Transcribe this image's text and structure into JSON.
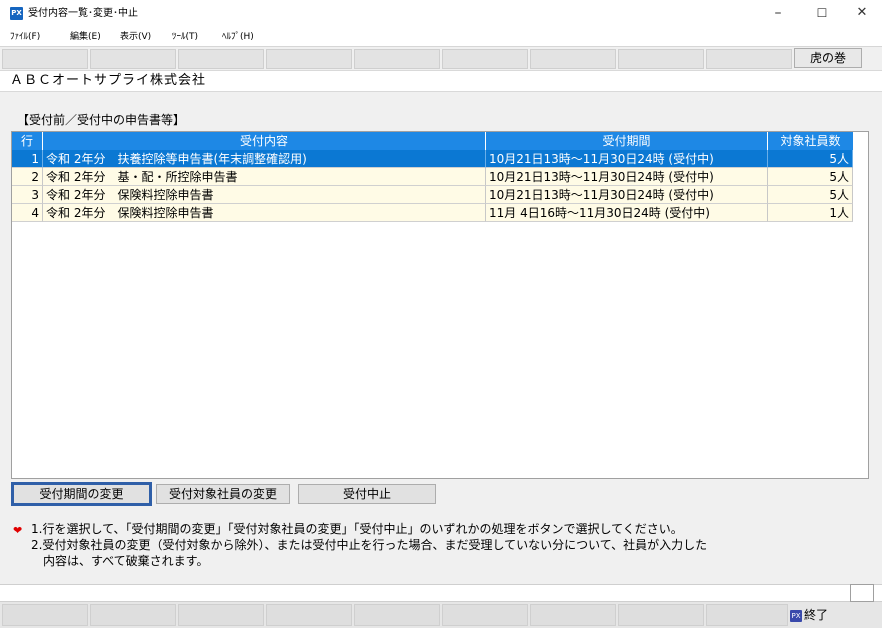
{
  "window": {
    "app_icon_text": "PX",
    "title": "受付内容一覧･変更･中止",
    "minimize_glyph": "–",
    "maximize_glyph": "☐",
    "close_glyph": "✕"
  },
  "menu": {
    "items": [
      "ﾌｧｲﾙ(F)",
      "編集(E)",
      "表示(V)",
      "ﾂｰﾙ(T)",
      "ﾍﾙﾌﾟ(H)"
    ]
  },
  "toolbar": {
    "tora_label": "虎の巻"
  },
  "company": {
    "name": "ＡＢＣオートサプライ株式会社"
  },
  "section": {
    "title": "【受付前／受付中の申告書等】"
  },
  "table": {
    "headers": [
      "行",
      "受付内容",
      "受付期間",
      "対象社員数"
    ],
    "rows": [
      {
        "no": "1",
        "content": "令和 2年分　扶養控除等申告書(年末調整確認用)",
        "period": "10月21日13時～11月30日24時 (受付中)",
        "count": "5人",
        "selected": true
      },
      {
        "no": "2",
        "content": "令和 2年分　基・配・所控除申告書",
        "period": "10月21日13時～11月30日24時 (受付中)",
        "count": "5人",
        "selected": false
      },
      {
        "no": "3",
        "content": "令和 2年分　保険料控除申告書",
        "period": "10月21日13時～11月30日24時 (受付中)",
        "count": "5人",
        "selected": false
      },
      {
        "no": "4",
        "content": "令和 2年分　保険料控除申告書",
        "period": "11月 4日16時～11月30日24時 (受付中)",
        "count": "1人",
        "selected": false
      }
    ]
  },
  "buttons": {
    "change_period": "受付期間の変更",
    "change_employees": "受付対象社員の変更",
    "stop": "受付中止"
  },
  "notes": {
    "icon": "heart-icon",
    "line1": "1.行を選択して、「受付期間の変更」「受付対象社員の変更」「受付中止」のいずれかの処理をボタンで選択してください。",
    "line2": "2.受付対象社員の変更（受付対象から除外）、または受付中止を行った場合、まだ受理していない分について、社員が入力した",
    "line3": "内容は、すべて破棄されます。"
  },
  "status": {
    "exit_icon_text": "PX",
    "exit_label": "終了"
  },
  "colors": {
    "header_blue": "#1e88e5",
    "selected_row": "#0b78d3",
    "row_bg": "#fffbe6",
    "heart_red": "#e00000"
  }
}
